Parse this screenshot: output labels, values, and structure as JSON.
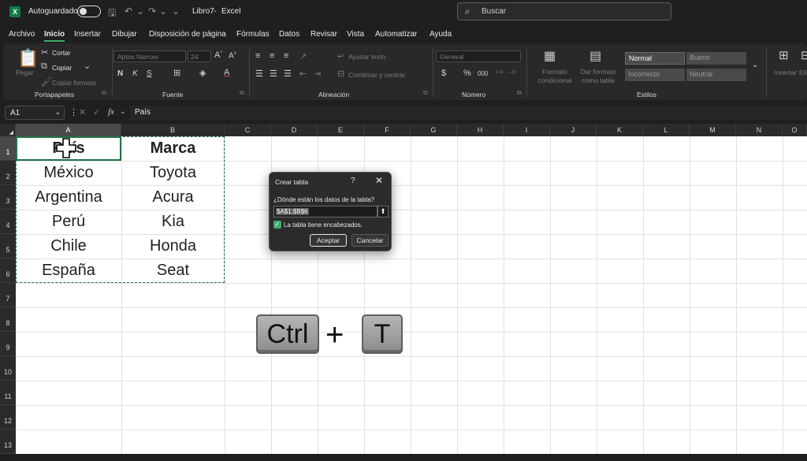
{
  "titlebar": {
    "autosave_label": "Autoguardado",
    "filename": "Libro7",
    "separator": "-",
    "app_name": "Excel",
    "search_placeholder": "Buscar"
  },
  "menu": {
    "tabs": [
      "Archivo",
      "Inicio",
      "Insertar",
      "Dibujar",
      "Disposición de página",
      "Fórmulas",
      "Datos",
      "Revisar",
      "Vista",
      "Automatizar",
      "Ayuda"
    ],
    "active": "Inicio"
  },
  "ribbon": {
    "clipboard": {
      "paste": "Pegar",
      "cut": "Cortar",
      "copy": "Copiar",
      "format_painter": "Copiar formato",
      "label": "Portapapeles"
    },
    "font": {
      "name": "Aptos Narrow",
      "size": "24",
      "label": "Fuente",
      "bold": "N",
      "italic": "K",
      "underline": "S"
    },
    "alignment": {
      "wrap": "Ajustar texto",
      "merge": "Combinar y centrar",
      "label": "Alineación"
    },
    "number": {
      "format": "General",
      "currency": "$",
      "percent": "%",
      "thousands": "000",
      "label": "Número"
    },
    "styles": {
      "conditional": "Formato condicional",
      "as_table": "Dar formato como tabla",
      "normal": "Normal",
      "good": "Bueno",
      "bad": "Incorrecto",
      "neutral": "Neutral",
      "label": "Estilos"
    },
    "cells": {
      "insert": "Insertar",
      "delete": "Eli"
    }
  },
  "formula_bar": {
    "name_box": "A1",
    "fx": "fx",
    "content": "País"
  },
  "columns": [
    "A",
    "B",
    "C",
    "D",
    "E",
    "F",
    "G",
    "H",
    "I",
    "J",
    "K",
    "L",
    "M",
    "N",
    "O"
  ],
  "rows": [
    "1",
    "2",
    "3",
    "4",
    "5",
    "6",
    "7",
    "8",
    "9",
    "10",
    "11",
    "12",
    "13"
  ],
  "sheet": {
    "A1": "País",
    "B1": "Marca",
    "A2": "México",
    "B2": "Toyota",
    "A3": "Argentina",
    "B3": "Acura",
    "A4": "Perú",
    "B4": "Kia",
    "A5": "Chile",
    "B5": "Honda",
    "A6": "España",
    "B6": "Seat"
  },
  "dialog": {
    "title": "Crear tabla",
    "help": "?",
    "close": "✕",
    "question": "¿Dónde están los datos de la tabla?",
    "range": "$A$1:$B$6",
    "has_headers_label": "La tabla tiene encabezados.",
    "has_headers_checked": true,
    "ok": "Aceptar",
    "cancel": "Cancelar"
  },
  "shortcut": {
    "key1": "Ctrl",
    "plus": "+",
    "key2": "T"
  }
}
